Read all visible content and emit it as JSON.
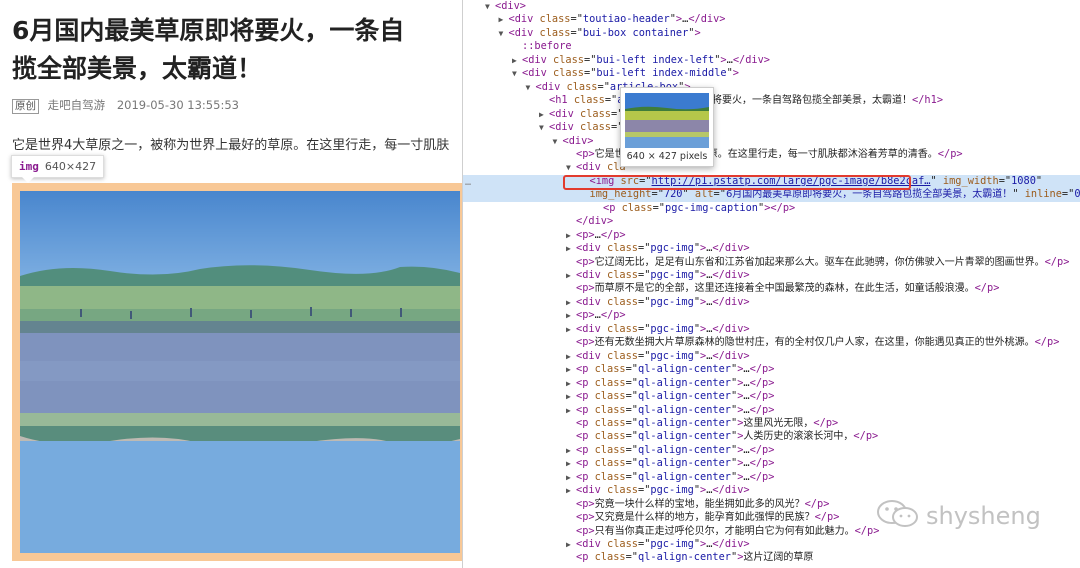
{
  "article": {
    "title_line1": "6月国内最美草原即将要火，一条自",
    "title_line2": "揽全部美景，太霸道！",
    "original_tag": "原创",
    "author": "走吧自驾游",
    "datetime": "2019-05-30 13:55:53",
    "paragraph": "它是世界4大草原之一，被称为世界上最好的草原。在这里行走，每一寸肌肤",
    "img_tooltip": {
      "tag": "img",
      "size": "640×427"
    }
  },
  "devtools": {
    "popup_size": "640 × 427 pixels",
    "lines": [
      {
        "indent": 0,
        "tri": "▼",
        "html": "<span class='tn'>&lt;div&gt;</span>"
      },
      {
        "indent": 1,
        "tri": "▶",
        "html": "<span class='tn'>&lt;div </span><span class='an'>class</span>=\"<span class='av'>toutiao-header</span>\"<span class='tn'>&gt;</span>…<span class='tn'>&lt;/div&gt;</span>"
      },
      {
        "indent": 1,
        "tri": "▼",
        "html": "<span class='tn'>&lt;div </span><span class='an'>class</span>=\"<span class='av'>bui-box container</span>\"<span class='tn'>&gt;</span>"
      },
      {
        "indent": 2,
        "tri": "",
        "html": "<span class='ps'>::before</span>"
      },
      {
        "indent": 2,
        "tri": "▶",
        "html": "<span class='tn'>&lt;div </span><span class='an'>class</span>=\"<span class='av'>bui-left index-left</span>\"<span class='tn'>&gt;</span>…<span class='tn'>&lt;/div&gt;</span>"
      },
      {
        "indent": 2,
        "tri": "▼",
        "html": "<span class='tn'>&lt;div </span><span class='an'>class</span>=\"<span class='av'>bui-left index-middle</span>\"<span class='tn'>&gt;</span>"
      },
      {
        "indent": 3,
        "tri": "▼",
        "html": "<span class='tn'>&lt;div </span><span class='an'>class</span>=\"<span class='av'>article-box</span>\"<span class='tn'>&gt;</span>"
      },
      {
        "indent": 4,
        "tri": "",
        "html": "<span class='tn'>&lt;h1 </span><span class='an'>class</span>=\"<span class='av'>art</span>                <span class='txt'>国内最美草原即将要火，一条自驾路包揽全部美景，太霸道！</span><span class='tn'>&lt;/h1&gt;</span>"
      },
      {
        "indent": 4,
        "tri": "▶",
        "html": "<span class='tn'>&lt;div </span><span class='an'>class</span>=\"<span class='av'>a</span>                    <span class='tn'>iv&gt;</span>"
      },
      {
        "indent": 4,
        "tri": "▼",
        "html": "<span class='tn'>&lt;div </span><span class='an'>class</span>=\"<span class='av'>a</span>"
      },
      {
        "indent": 5,
        "tri": "▼",
        "html": "<span class='tn'>&lt;div&gt;</span>"
      },
      {
        "indent": 6,
        "tri": "",
        "html": "<span class='tn'>&lt;p&gt;</span><span class='txt'>它是世界                  世界上最好的草原。在这里行走，每一寸肌肤都沐浴着芳草的清香。</span><span class='tn'>&lt;/p&gt;</span>"
      },
      {
        "indent": 6,
        "tri": "▼",
        "html": "<span class='tn'>&lt;div </span><span class='an'>cla</span>"
      },
      {
        "indent": 7,
        "tri": "",
        "sel": true,
        "html": "<span class='tn'>&lt;img </span><span class='an'>src</span>=\"<span class='av' style='text-decoration:underline'>http://p1.pstatp.com/large/pgc-image/b8e2caf…</span>\" <span class='an'>img_width</span>=\"<span class='av'>1080</span>\""
      },
      {
        "indent": 7,
        "tri": "",
        "sel": true,
        "html": "<span class='an'>img_height</span>=\"<span class='av'>720</span>\" <span class='an'>alt</span>=\"<span class='av txt' style='color:#1a1aa6'>6月国内最美草原即将要火，一条自驾路包揽全部美景，太霸道！</span>\" <span class='an'>inline</span>=\"<span class='av'>0</span>\" <span class='tn'>&gt;</span> =="
      },
      {
        "indent": 8,
        "tri": "",
        "html": "<span class='tn'>&lt;p </span><span class='an'>class</span>=\"<span class='av'>pgc-img-caption</span>\"<span class='tn'>&gt;&lt;/p&gt;</span>"
      },
      {
        "indent": 6,
        "tri": "",
        "html": "<span class='tn'>&lt;/div&gt;</span>"
      },
      {
        "indent": 6,
        "tri": "▶",
        "html": "<span class='tn'>&lt;p&gt;</span>…<span class='tn'>&lt;/p&gt;</span>"
      },
      {
        "indent": 6,
        "tri": "▶",
        "html": "<span class='tn'>&lt;div </span><span class='an'>class</span>=\"<span class='av'>pgc-img</span>\"<span class='tn'>&gt;</span>…<span class='tn'>&lt;/div&gt;</span>"
      },
      {
        "indent": 6,
        "tri": "",
        "html": "<span class='tn'>&lt;p&gt;</span><span class='txt'>它辽阔无比，足足有山东省和江苏省加起来那么大。驱车在此驰骋，你仿佛驶入一片青翠的图画世界。</span><span class='tn'>&lt;/p&gt;</span>"
      },
      {
        "indent": 6,
        "tri": "▶",
        "html": "<span class='tn'>&lt;div </span><span class='an'>class</span>=\"<span class='av'>pgc-img</span>\"<span class='tn'>&gt;</span>…<span class='tn'>&lt;/div&gt;</span>"
      },
      {
        "indent": 6,
        "tri": "",
        "html": "<span class='tn'>&lt;p&gt;</span><span class='txt'>而草原不是它的全部，这里还连接着全中国最繁茂的森林，在此生活，如童话般浪漫。</span><span class='tn'>&lt;/p&gt;</span>"
      },
      {
        "indent": 6,
        "tri": "▶",
        "html": "<span class='tn'>&lt;div </span><span class='an'>class</span>=\"<span class='av'>pgc-img</span>\"<span class='tn'>&gt;</span>…<span class='tn'>&lt;/div&gt;</span>"
      },
      {
        "indent": 6,
        "tri": "▶",
        "html": "<span class='tn'>&lt;p&gt;</span>…<span class='tn'>&lt;/p&gt;</span>"
      },
      {
        "indent": 6,
        "tri": "▶",
        "html": "<span class='tn'>&lt;div </span><span class='an'>class</span>=\"<span class='av'>pgc-img</span>\"<span class='tn'>&gt;</span>…<span class='tn'>&lt;/div&gt;</span>"
      },
      {
        "indent": 6,
        "tri": "",
        "html": "<span class='tn'>&lt;p&gt;</span><span class='txt'>还有无数坐拥大片草原森林的隐世村庄，有的全村仅几户人家，在这里，你能遇见真正的世外桃源。</span><span class='tn'>&lt;/p&gt;</span>"
      },
      {
        "indent": 6,
        "tri": "▶",
        "html": "<span class='tn'>&lt;div </span><span class='an'>class</span>=\"<span class='av'>pgc-img</span>\"<span class='tn'>&gt;</span>…<span class='tn'>&lt;/div&gt;</span>"
      },
      {
        "indent": 6,
        "tri": "▶",
        "html": "<span class='tn'>&lt;p </span><span class='an'>class</span>=\"<span class='av'>ql-align-center</span>\"<span class='tn'>&gt;</span>…<span class='tn'>&lt;/p&gt;</span>"
      },
      {
        "indent": 6,
        "tri": "▶",
        "html": "<span class='tn'>&lt;p </span><span class='an'>class</span>=\"<span class='av'>ql-align-center</span>\"<span class='tn'>&gt;</span>…<span class='tn'>&lt;/p&gt;</span>"
      },
      {
        "indent": 6,
        "tri": "▶",
        "html": "<span class='tn'>&lt;p </span><span class='an'>class</span>=\"<span class='av'>ql-align-center</span>\"<span class='tn'>&gt;</span>…<span class='tn'>&lt;/p&gt;</span>"
      },
      {
        "indent": 6,
        "tri": "▶",
        "html": "<span class='tn'>&lt;p </span><span class='an'>class</span>=\"<span class='av'>ql-align-center</span>\"<span class='tn'>&gt;</span>…<span class='tn'>&lt;/p&gt;</span>"
      },
      {
        "indent": 6,
        "tri": "",
        "html": "<span class='tn'>&lt;p </span><span class='an'>class</span>=\"<span class='av'>ql-align-center</span>\"<span class='tn'>&gt;</span><span class='txt'>这里风光无限，</span><span class='tn'>&lt;/p&gt;</span>"
      },
      {
        "indent": 6,
        "tri": "",
        "html": "<span class='tn'>&lt;p </span><span class='an'>class</span>=\"<span class='av'>ql-align-center</span>\"<span class='tn'>&gt;</span><span class='txt'>人类历史的滚滚长河中，</span><span class='tn'>&lt;/p&gt;</span>"
      },
      {
        "indent": 6,
        "tri": "▶",
        "html": "<span class='tn'>&lt;p </span><span class='an'>class</span>=\"<span class='av'>ql-align-center</span>\"<span class='tn'>&gt;</span>…<span class='tn'>&lt;/p&gt;</span>"
      },
      {
        "indent": 6,
        "tri": "▶",
        "html": "<span class='tn'>&lt;p </span><span class='an'>class</span>=\"<span class='av'>ql-align-center</span>\"<span class='tn'>&gt;</span>…<span class='tn'>&lt;/p&gt;</span>"
      },
      {
        "indent": 6,
        "tri": "▶",
        "html": "<span class='tn'>&lt;p </span><span class='an'>class</span>=\"<span class='av'>ql-align-center</span>\"<span class='tn'>&gt;</span>…<span class='tn'>&lt;/p&gt;</span>"
      },
      {
        "indent": 6,
        "tri": "▶",
        "html": "<span class='tn'>&lt;div </span><span class='an'>class</span>=\"<span class='av'>pgc-img</span>\"<span class='tn'>&gt;</span>…<span class='tn'>&lt;/div&gt;</span>"
      },
      {
        "indent": 6,
        "tri": "",
        "html": "<span class='tn'>&lt;p&gt;</span><span class='txt'>究竟一块什么样的宝地，能坐拥如此多的风光？</span><span class='tn'>&lt;/p&gt;</span>"
      },
      {
        "indent": 6,
        "tri": "",
        "html": "<span class='tn'>&lt;p&gt;</span><span class='txt'>又究竟是什么样的地方，能孕育如此强悍的民族？</span><span class='tn'>&lt;/p&gt;</span>"
      },
      {
        "indent": 6,
        "tri": "",
        "html": "<span class='tn'>&lt;p&gt;</span><span class='txt'>只有当你真正走过呼伦贝尔，才能明白它为何有如此魅力。</span><span class='tn'>&lt;/p&gt;</span>"
      },
      {
        "indent": 6,
        "tri": "▶",
        "html": "<span class='tn'>&lt;div </span><span class='an'>class</span>=\"<span class='av'>pgc-img</span>\"<span class='tn'>&gt;</span>…<span class='tn'>&lt;/div&gt;</span>"
      },
      {
        "indent": 6,
        "tri": "",
        "html": "<span class='tn'>&lt;p </span><span class='an'>class</span>=\"<span class='av'>ql-align-center</span>\"<span class='tn'>&gt;</span><span class='txt'>这片辽阔的草原</span>"
      }
    ]
  },
  "watermark": "shysheng"
}
